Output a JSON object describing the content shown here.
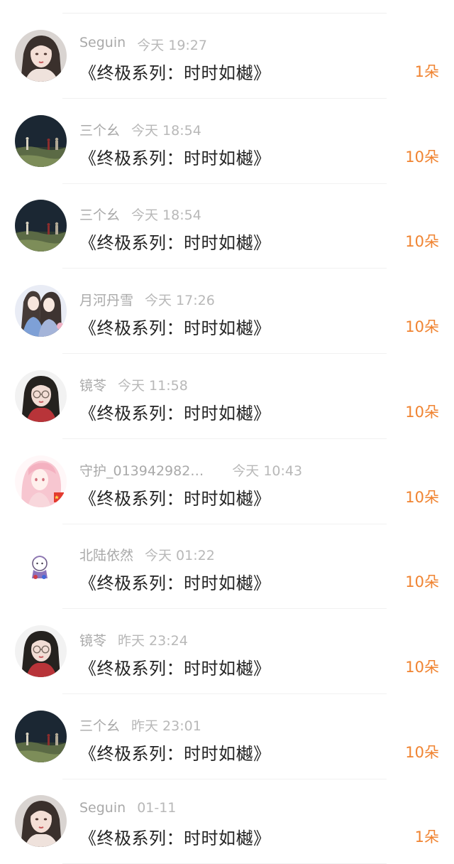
{
  "rows": [
    {
      "name": "Seguin",
      "time": "今天 19:27",
      "title": "《终极系列：时时如樾》",
      "amount": "1朵",
      "avatar_icon": "woman-portrait-avatar-icon"
    },
    {
      "name": "三个幺",
      "time": "今天 18:54",
      "title": "《终极系列：时时如樾》",
      "amount": "10朵",
      "avatar_icon": "night-field-avatar-icon"
    },
    {
      "name": "三个幺",
      "time": "今天 18:54",
      "title": "《终极系列：时时如樾》",
      "amount": "10朵",
      "avatar_icon": "night-field-avatar-icon"
    },
    {
      "name": "月河丹雪",
      "time": "今天 17:26",
      "title": "《终极系列：时时如樾》",
      "amount": "10朵",
      "avatar_icon": "two-girls-avatar-icon"
    },
    {
      "name": "镜苓",
      "time": "今天 11:58",
      "title": "《终极系列：时时如樾》",
      "amount": "10朵",
      "avatar_icon": "girl-with-glasses-avatar-icon"
    },
    {
      "name": "守护_013942982…",
      "time": "今天 10:43",
      "title": "《终极系列：时时如樾》",
      "amount": "10朵",
      "avatar_icon": "pink-anime-girl-avatar-icon"
    },
    {
      "name": "北陆依然",
      "time": "今天 01:22",
      "title": "《终极系列：时时如樾》",
      "amount": "10朵",
      "avatar_icon": "small-cartoon-avatar-icon"
    },
    {
      "name": "镜苓",
      "time": "昨天 23:24",
      "title": "《终极系列：时时如樾》",
      "amount": "10朵",
      "avatar_icon": "girl-with-glasses-avatar-icon"
    },
    {
      "name": "三个幺",
      "time": "昨天 23:01",
      "title": "《终极系列：时时如樾》",
      "amount": "10朵",
      "avatar_icon": "night-field-avatar-icon"
    },
    {
      "name": "Seguin",
      "time": "01-11",
      "title": "《终极系列：时时如樾》",
      "amount": "1朵",
      "avatar_icon": "woman-portrait-avatar-icon"
    }
  ],
  "colors": {
    "amount": "#f08330",
    "title": "#242424",
    "meta": "#b1b1b1",
    "divider": "#f1f1f1"
  }
}
